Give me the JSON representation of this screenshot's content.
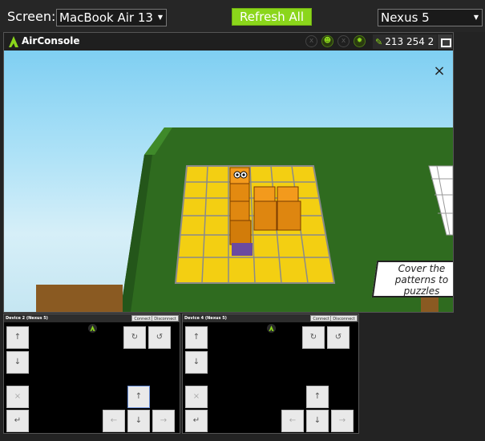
{
  "topbar": {
    "screen_label": "Screen:",
    "screen_select": "MacBook Air 13",
    "refresh_label": "Refresh All",
    "device_select": "Nexus 5"
  },
  "airconsole": {
    "title": "AirConsole",
    "code": "213 254 2",
    "accent": "#8bd61b"
  },
  "game": {
    "close": "×",
    "hint_text": "Cover the patterns to puzzles"
  },
  "controllers": [
    {
      "name": "Device 2 (Nexus 5)",
      "connect": "Connect",
      "disconnect": "Disconnect",
      "buttons": {
        "up_left": "↑",
        "down_left": "↓",
        "rotate_cw": "↻",
        "rotate_ccw": "↺",
        "cancel": "×",
        "enter": "↵",
        "up": "↑",
        "left": "←",
        "down": "↓",
        "right": "→"
      }
    },
    {
      "name": "Device 4 (Nexus 5)",
      "connect": "Connect",
      "disconnect": "Disconnect",
      "buttons": {
        "up_left": "↑",
        "down_left": "↓",
        "rotate_cw": "↻",
        "rotate_ccw": "↺",
        "cancel": "×",
        "enter": "↵",
        "up": "↑",
        "left": "←",
        "down": "↓",
        "right": "→"
      }
    }
  ]
}
